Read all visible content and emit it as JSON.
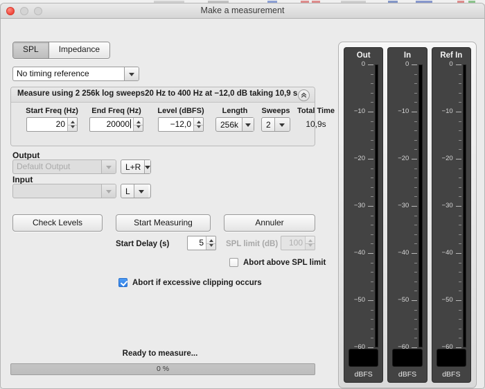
{
  "window": {
    "title": "Make a measurement",
    "traffic_lights": [
      "close",
      "minimize",
      "maximize"
    ]
  },
  "tabs": {
    "items": [
      {
        "label": "SPL",
        "selected": true
      },
      {
        "label": "Impedance",
        "selected": false
      }
    ]
  },
  "timing_reference": {
    "label": "No timing reference",
    "enabled": true
  },
  "measure_group": {
    "header": "Measure using 2 256k log sweeps20 Hz to 400 Hz at −12,0 dB taking 10,9 s",
    "collapse_icon": "chevron-double-up-icon",
    "fields": [
      {
        "name": "start-freq",
        "label": "Start Freq (Hz)",
        "value": "20",
        "type": "spinner",
        "enabled": true,
        "caret": false
      },
      {
        "name": "end-freq",
        "label": "End Freq (Hz)",
        "value": "20000",
        "type": "spinner",
        "enabled": true,
        "caret": true
      },
      {
        "name": "level",
        "label": "Level (dBFS)",
        "value": "−12,0",
        "type": "spinner",
        "enabled": true,
        "caret": false
      },
      {
        "name": "length",
        "label": "Length",
        "value": "256k",
        "type": "select",
        "enabled": true
      },
      {
        "name": "sweeps",
        "label": "Sweeps",
        "value": "2",
        "type": "select",
        "enabled": true
      },
      {
        "name": "total-time",
        "label": "Total Time",
        "value": "10,9s",
        "type": "text",
        "enabled": true
      }
    ]
  },
  "io": {
    "output": {
      "label": "Output",
      "device": "Default Output",
      "device_enabled": false,
      "channel": "L+R"
    },
    "input": {
      "label": "Input",
      "device": "",
      "device_enabled": false,
      "channel": "L"
    }
  },
  "buttons": {
    "check_levels": "Check Levels",
    "start_measuring": "Start Measuring",
    "cancel": "Annuler"
  },
  "delay": {
    "label": "Start Delay (s)",
    "value": "5",
    "enabled": true
  },
  "spl_limit": {
    "label": "SPL limit (dB)",
    "value": "100",
    "enabled": false
  },
  "checkboxes": [
    {
      "name": "abort-above-spl-limit",
      "label": "Abort above SPL limit",
      "checked": false
    },
    {
      "name": "abort-if-clipping",
      "label": "Abort if excessive clipping occurs",
      "checked": true
    }
  ],
  "status": {
    "message": "Ready to measure...",
    "progress_label": "0 %",
    "progress_percent": 0
  },
  "meters": {
    "scale_labels": [
      "0",
      "−10",
      "−20",
      "−30",
      "−40",
      "−50",
      "−60"
    ],
    "unit": "dBFS",
    "channels": [
      {
        "name": "out",
        "title": "Out",
        "level_db": -60,
        "readout": ""
      },
      {
        "name": "in",
        "title": "In",
        "level_db": -60,
        "readout": ""
      },
      {
        "name": "ref-in",
        "title": "Ref In",
        "level_db": -60,
        "readout": ""
      }
    ]
  },
  "colors": {
    "window_bg": "#ebebeb",
    "accent_checkbox": "#2f7fe4",
    "meter_panel": "#434343",
    "meter_bar": "#000000",
    "close_button": "#f0483c"
  }
}
